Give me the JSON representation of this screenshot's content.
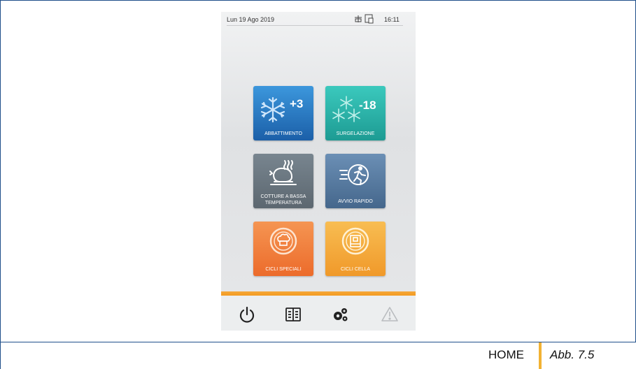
{
  "status": {
    "date": "Lun 19 Ago 2019",
    "time": "16:11"
  },
  "tiles": [
    {
      "label": "ABBATTIMENTO",
      "value": "+3",
      "icon": "snowflake-icon",
      "color": "#2a7cc7"
    },
    {
      "label": "SURGELAZIONE",
      "value": "-18",
      "icon": "triple-snowflake-icon",
      "color": "#2bb3a8"
    },
    {
      "label_line1": "COTTURE A BASSA",
      "label_line2": "TEMPERATURA",
      "icon": "roast-chicken-icon",
      "color": "#6a7680"
    },
    {
      "label": "AVVIO RAPIDO",
      "icon": "running-man-icon",
      "color": "#5a7ca1"
    },
    {
      "label": "CICLI SPECIALI",
      "icon": "chef-hat-icon",
      "color": "#f07f3a"
    },
    {
      "label": "CICLI CELLA",
      "icon": "cell-box-icon",
      "color": "#f4ab3c"
    }
  ],
  "bottom_nav": [
    "power-icon",
    "manual-book-icon",
    "settings-gears-icon",
    "warning-icon"
  ],
  "caption": {
    "section": "HOME",
    "figure": "Abb. 7.5"
  },
  "accent_color": "#f39a20"
}
